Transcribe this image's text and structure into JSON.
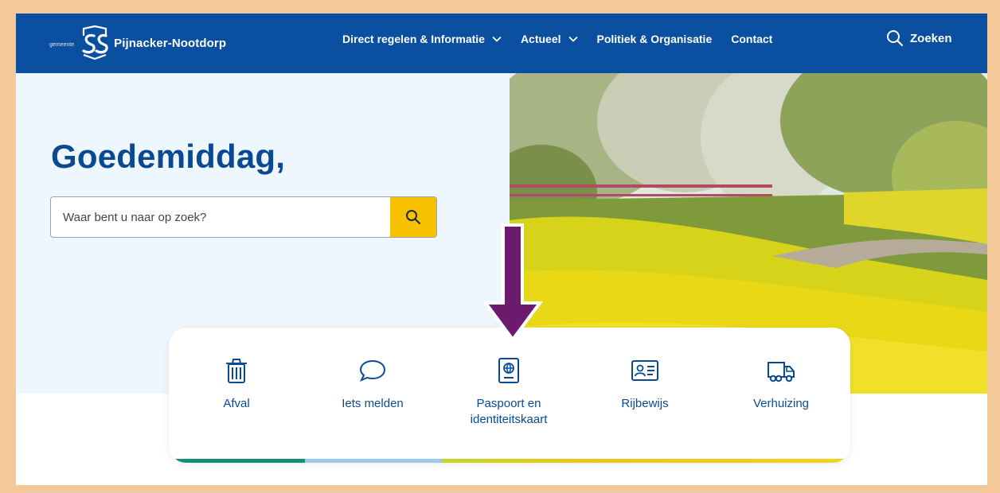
{
  "header": {
    "logo_small": "gemeente",
    "logo_name": "Pijnacker-Nootdorp",
    "nav": [
      {
        "label": "Direct regelen & Informatie",
        "has_dropdown": true
      },
      {
        "label": "Actueel",
        "has_dropdown": true
      },
      {
        "label": "Politiek & Organisatie",
        "has_dropdown": false
      },
      {
        "label": "Contact",
        "has_dropdown": false
      }
    ],
    "search_label": "Zoeken"
  },
  "hero": {
    "greeting": "Goedemiddag,",
    "search_placeholder": "Waar bent u naar op zoek?"
  },
  "quick_links": [
    {
      "label": "Afval",
      "icon": "trash-icon"
    },
    {
      "label": "Iets melden",
      "icon": "speech-bubble-icon"
    },
    {
      "label": "Paspoort en identiteitskaart",
      "icon": "passport-icon"
    },
    {
      "label": "Rijbewijs",
      "icon": "id-card-icon"
    },
    {
      "label": "Verhuizing",
      "icon": "moving-truck-icon"
    }
  ],
  "colors": {
    "header_bg": "#0b4fa0",
    "accent_yellow": "#f8c100",
    "text_blue": "#0b4a92",
    "arrow_purple": "#6b1a6e"
  }
}
